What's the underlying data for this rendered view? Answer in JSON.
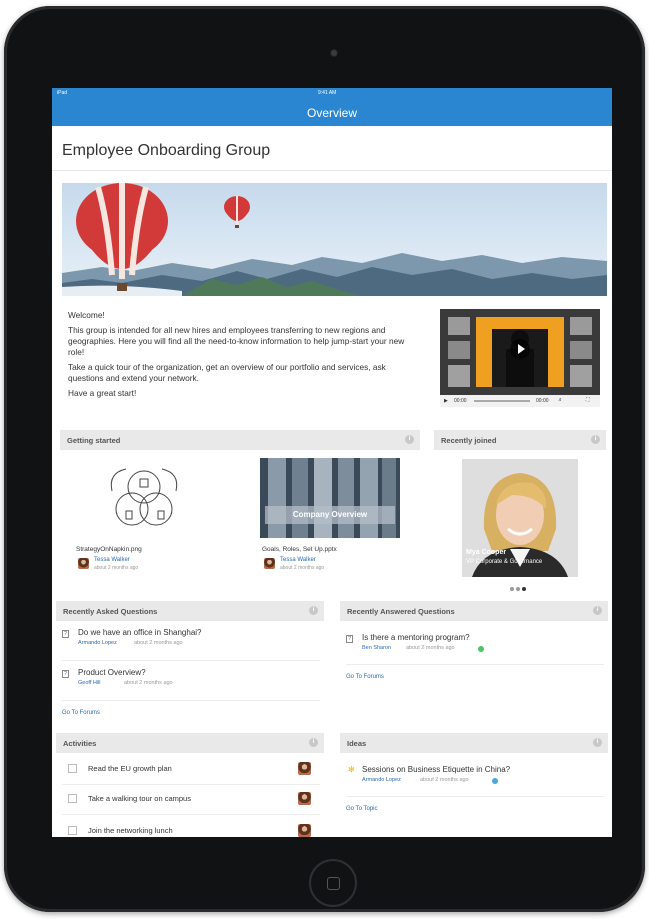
{
  "status": {
    "carrier": "iPad",
    "time": "9:41 AM"
  },
  "header": {
    "title": "Overview"
  },
  "group": {
    "title": "Employee Onboarding Group"
  },
  "welcome": {
    "p1": "Welcome!",
    "p2": "This group is intended for all new hires and employees transferring to new regions and geographies. Here you will find all the need-to-know information to help jump-start your new role!",
    "p3": "Take a quick tour of the organization, get an overview of our portfolio and services, ask questions and extend your network.",
    "p4": "Have a great start!"
  },
  "video": {
    "current": "00:00",
    "duration": "00:00"
  },
  "getting_started": {
    "title": "Getting started",
    "files": [
      {
        "name": "StrategyOnNapkin.png",
        "author": "Tessa Walker",
        "time": "about 2 months ago"
      },
      {
        "name": "Goals, Roles, Set Up.pptx",
        "author": "Tessa Walker",
        "time": "about 2 months ago",
        "overlay": "Company Overview"
      }
    ]
  },
  "recently_joined": {
    "title": "Recently joined",
    "person_name": "Mya Cooper",
    "person_role": "VP Corporate & Governance"
  },
  "asked": {
    "title": "Recently Asked Questions",
    "items": [
      {
        "question": "Do we have an office in Shanghai?",
        "author": "Armando Lopez",
        "time": "about 2 months ago"
      },
      {
        "question": "Product Overview?",
        "author": "Geoff Hill",
        "time": "about 2 months ago"
      }
    ],
    "link": "Go To Forums"
  },
  "answered": {
    "title": "Recently Answered Questions",
    "items": [
      {
        "question": "Is there a mentoring program?",
        "author": "Ben Sharon",
        "time": "about 2 months ago"
      }
    ],
    "link": "Go To Forums"
  },
  "activities": {
    "title": "Activities",
    "items": [
      {
        "label": "Read the EU growth plan"
      },
      {
        "label": "Take a walking tour on campus"
      },
      {
        "label": "Join the networking lunch"
      }
    ]
  },
  "ideas": {
    "title": "Ideas",
    "items": [
      {
        "label": "Sessions on Business Etiquette in China?",
        "author": "Armando Lopez",
        "time": "about 2 months ago"
      }
    ],
    "link": "Go To Topic"
  },
  "colors": {
    "accent": "#2a86d0",
    "link": "#2a6aaf",
    "panel_header": "#e9e9e9",
    "device": "#111214"
  },
  "icons": [
    "camera-icon",
    "home-button-icon",
    "info-icon",
    "play-icon",
    "question-icon",
    "lightbulb-icon",
    "checkbox-icon",
    "avatar-icon"
  ]
}
